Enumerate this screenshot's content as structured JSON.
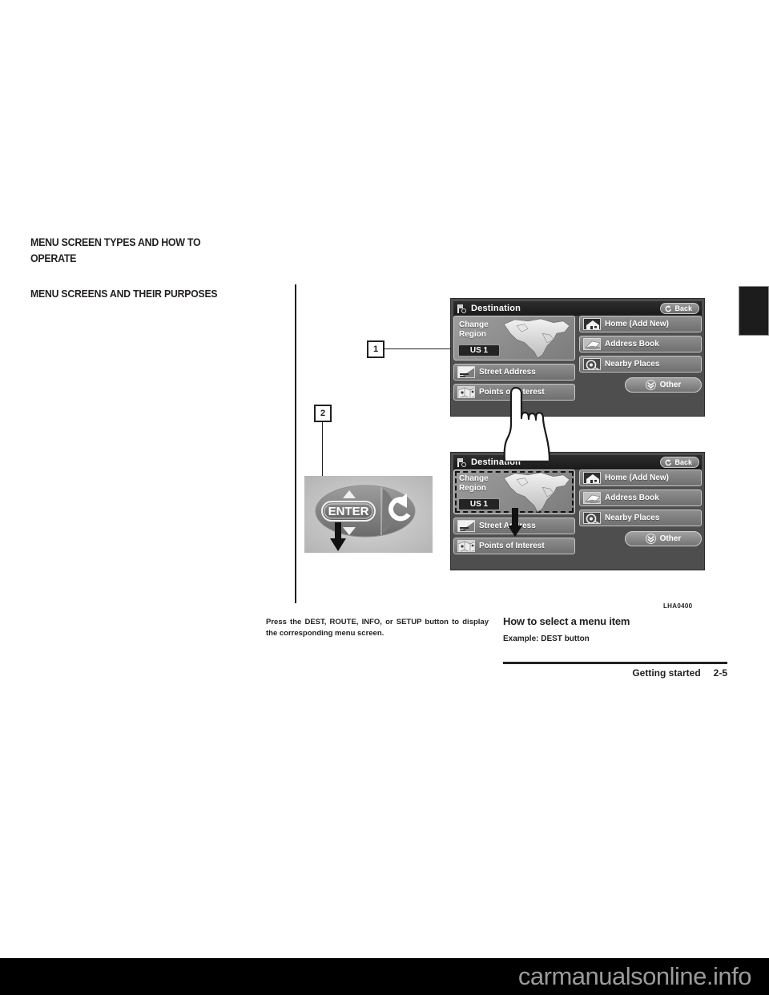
{
  "document": {
    "section_heading": "MENU SCREEN TYPES AND HOW TO OPERATE",
    "subsection_heading": "MENU SCREENS AND THEIR PURPOSES",
    "figure_code": "LHA0400",
    "body_left": "Press the DEST, ROUTE, INFO, or SETUP button to display the corresponding menu screen.",
    "right_heading": "How to select a menu item",
    "right_subheading": "Example: DEST button",
    "footer_chapter": "Getting started",
    "footer_page": "2-5",
    "watermark": "carmanualsonline.info"
  },
  "callouts": [
    {
      "number": "1"
    },
    {
      "number": "2"
    }
  ],
  "nav_screens": [
    {
      "title": "Destination",
      "title_icon": "destination-flag-icon",
      "back_label": "Back",
      "back_icon": "back-arrow-icon",
      "region": {
        "label": "Change\nRegion",
        "label_line1": "Change",
        "label_line2": "Region",
        "value": "US 1",
        "selected": false
      },
      "left_buttons": [
        {
          "label": "Street Address",
          "icon": "street-address-icon"
        },
        {
          "label": "Points of Interest",
          "icon": "points-of-interest-icon"
        }
      ],
      "right_buttons": [
        {
          "label": "Home (Add New)",
          "icon": "home-icon"
        },
        {
          "label": "Address Book",
          "icon": "address-book-icon"
        },
        {
          "label": "Nearby Places",
          "icon": "nearby-places-icon"
        }
      ],
      "other_label": "Other",
      "other_icon": "double-chevron-down-icon"
    },
    {
      "title": "Destination",
      "title_icon": "destination-flag-icon",
      "back_label": "Back",
      "back_icon": "back-arrow-icon",
      "region": {
        "label_line1": "Change",
        "label_line2": "Region",
        "value": "US 1",
        "selected": true
      },
      "left_buttons": [
        {
          "label": "Street Address",
          "icon": "street-address-icon"
        },
        {
          "label": "Points of Interest",
          "icon": "points-of-interest-icon"
        }
      ],
      "right_buttons": [
        {
          "label": "Home (Add New)",
          "icon": "home-icon"
        },
        {
          "label": "Address Book",
          "icon": "address-book-icon"
        },
        {
          "label": "Nearby Places",
          "icon": "nearby-places-icon"
        }
      ],
      "other_label": "Other",
      "other_icon": "double-chevron-down-icon"
    }
  ],
  "controller": {
    "enter_label": "ENTER",
    "up_icon": "triangle-up-icon",
    "down_icon": "triangle-down-icon",
    "back_icon": "return-arrow-icon"
  },
  "colors": {
    "ink": "#231f20",
    "screen_bg": "#4e4e4e",
    "titlebar": "#1a1a1a",
    "button": "#8e8e8e",
    "watermark_text": "#9b9b9b"
  }
}
